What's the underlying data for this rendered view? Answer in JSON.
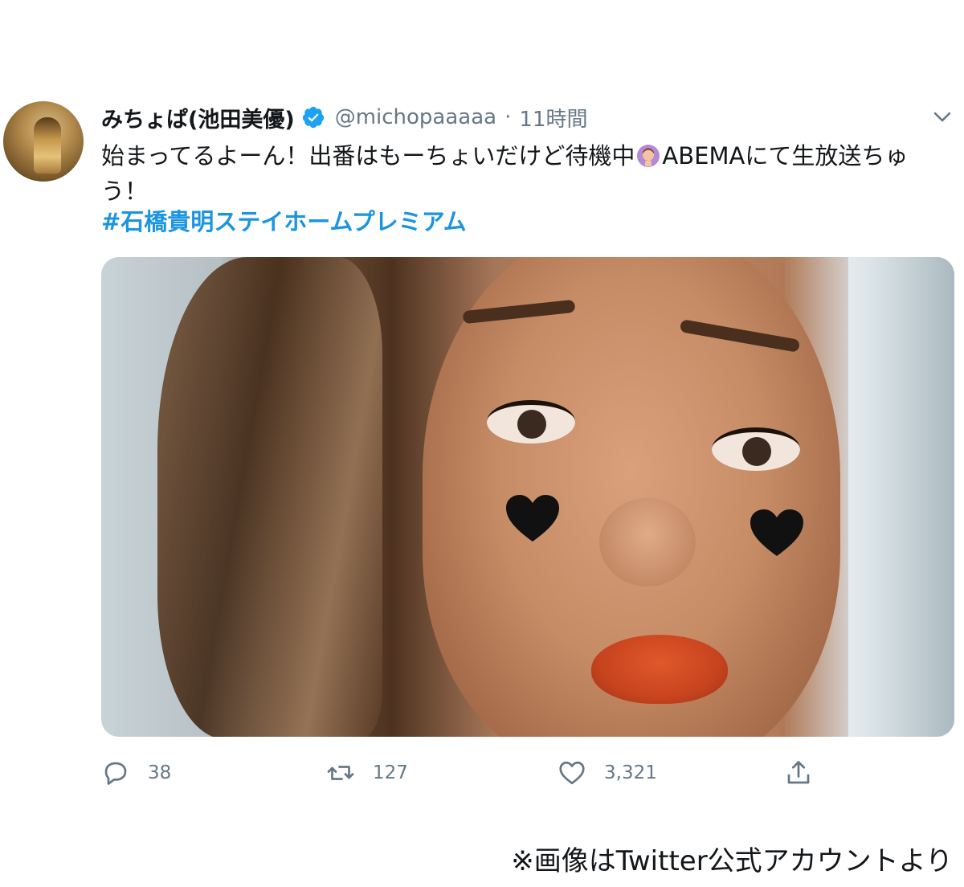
{
  "tweet": {
    "display_name": "みちょぱ(池田美優)",
    "handle": "@michopaaaaa",
    "separator": "·",
    "time": "11時間",
    "text_part1": "始まってるよーん！出番はもーちょいだけど待機中",
    "text_part2": "ABEMAにて生放送ちゅう！",
    "emoji_icon": "woman-gesturing-ok-emoji",
    "hashtag": "#石橋貴明ステイホームプレミアム",
    "verified_color": "#1da1f2",
    "link_color": "#1b95e0"
  },
  "actions": {
    "reply_count": "38",
    "retweet_count": "127",
    "like_count": "3,321"
  },
  "footer": {
    "caption": "※画像はTwitter公式アカウントより"
  }
}
